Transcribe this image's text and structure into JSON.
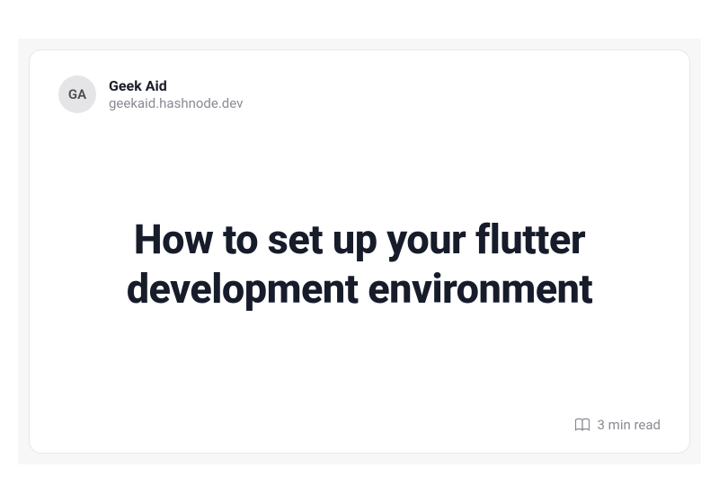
{
  "author": {
    "initials": "GA",
    "name": "Geek Aid",
    "domain": "geekaid.hashnode.dev"
  },
  "post": {
    "title": "How to set up your flutter development environment",
    "read_time": "3 min read"
  }
}
